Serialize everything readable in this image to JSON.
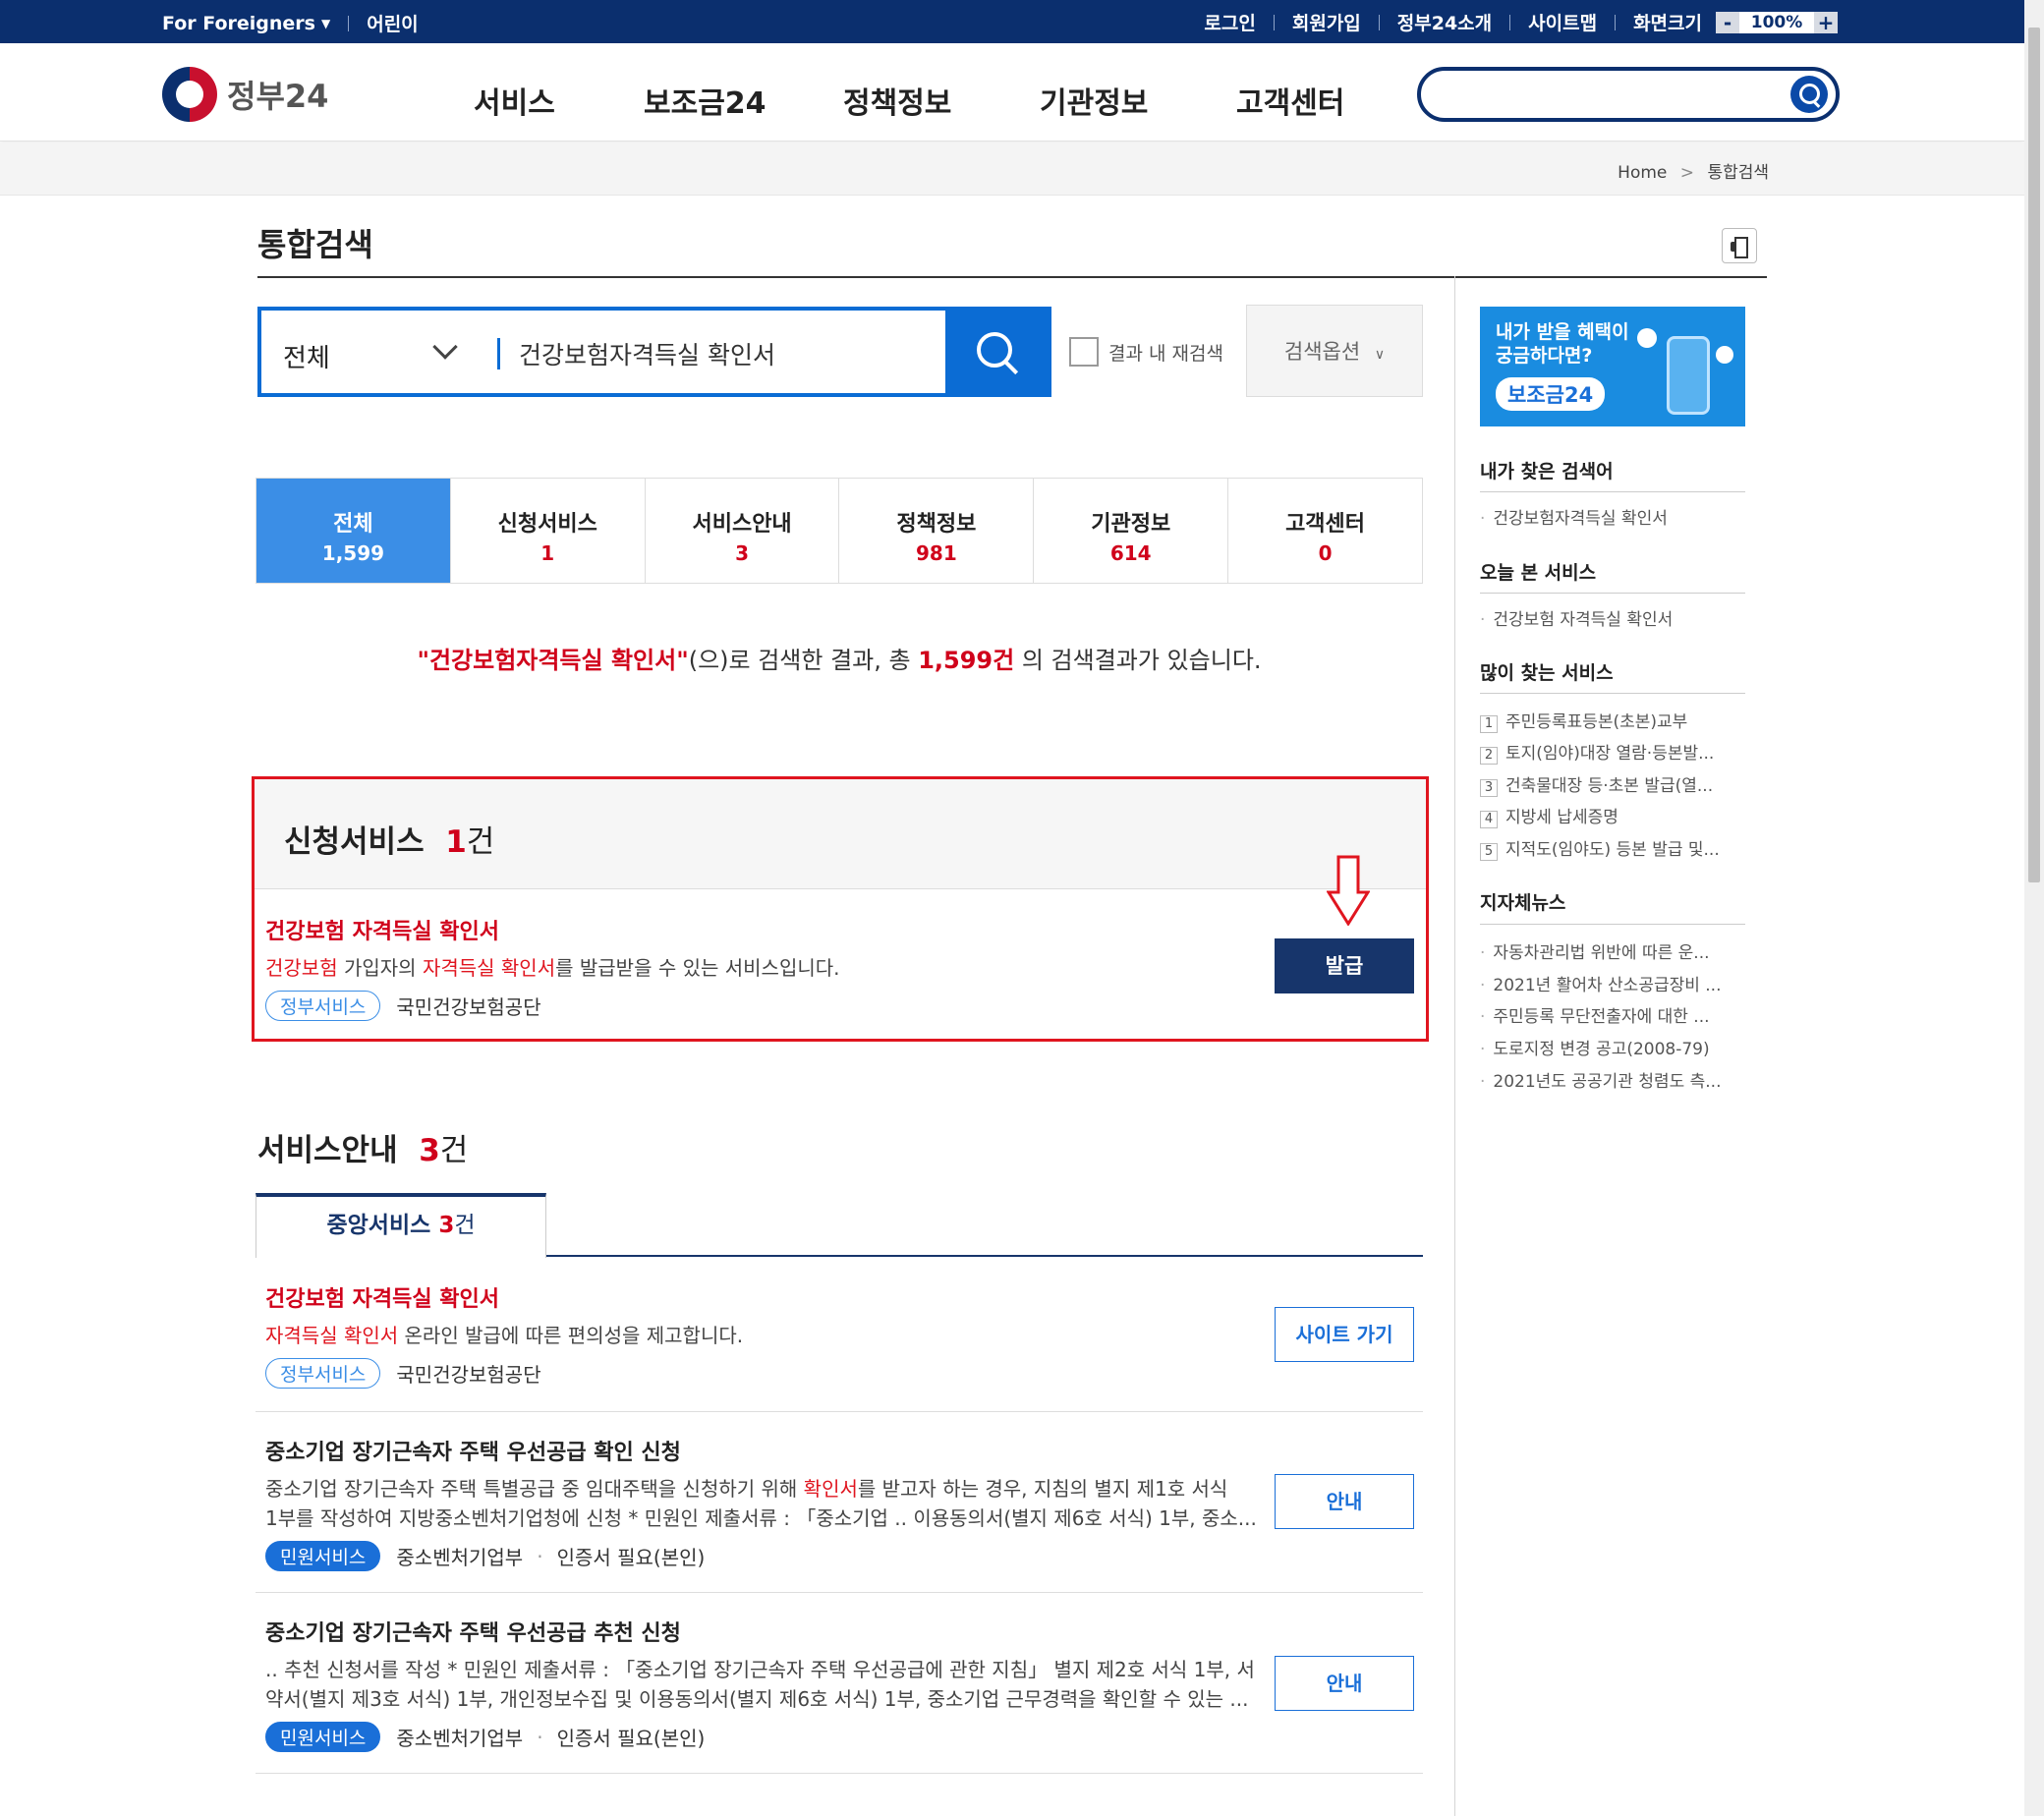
{
  "topbar": {
    "left": [
      "For Foreigners",
      "어린이"
    ],
    "right": [
      "로그인",
      "회원가입",
      "정부24소개",
      "사이트맵"
    ],
    "screen_size_label": "화면크기",
    "zoom_minus": "-",
    "zoom_value": "100%",
    "zoom_plus": "+"
  },
  "header": {
    "logo_text": "정부24",
    "menu": [
      "서비스",
      "보조금24",
      "정책정보",
      "기관정보",
      "고객센터"
    ]
  },
  "breadcrumb": {
    "home": "Home",
    "sep": ">",
    "current": "통합검색"
  },
  "page_title": "통합검색",
  "search": {
    "category": "전체",
    "query": "건강보험자격득실 확인서",
    "research_label": "결과 내 재검색",
    "options_label": "검색옵션"
  },
  "tabs": [
    {
      "label": "전체",
      "count": "1,599"
    },
    {
      "label": "신청서비스",
      "count": "1"
    },
    {
      "label": "서비스안내",
      "count": "3"
    },
    {
      "label": "정책정보",
      "count": "981"
    },
    {
      "label": "기관정보",
      "count": "614"
    },
    {
      "label": "고객센터",
      "count": "0"
    }
  ],
  "summary": {
    "quote": "\"건강보험자격득실 확인서\"",
    "mid": "(으)로 검색한 결과, 총 ",
    "total": "1,599건",
    "end": " 의 검색결과가 있습니다."
  },
  "apply_section": {
    "title": "신청서비스",
    "count": "1",
    "unit": "건",
    "item": {
      "title": "건강보험 자격득실 확인서",
      "desc_parts": [
        "건강보험",
        " 가입자의 ",
        "자격득실 확인서",
        "를 발급받을 수 있는 서비스입니다."
      ],
      "tag": "정부서비스",
      "org": "국민건강보험공단",
      "button": "발급"
    }
  },
  "guide_section": {
    "title": "서비스안내",
    "count": "3",
    "unit": "건",
    "subtab": {
      "label": "중앙서비스",
      "count": "3",
      "unit": "건"
    },
    "items": [
      {
        "title": "건강보험 자격득실 확인서",
        "desc_parts": [
          "자격득실 확인서",
          " 온라인 발급에 따른 편의성을 제고합니다."
        ],
        "tag": "정부서비스",
        "org": "국민건강보험공단",
        "button": "사이트 가기"
      },
      {
        "title": "중소기업 장기근속자 주택 우선공급 확인 신청",
        "desc_line1_parts": [
          "중소기업 장기근속자 주택 특별공급 중 임대주택을 신청하기 위해 ",
          "확인서",
          "를 받고자 하는 경우, 지침의 별지 제1호 서식"
        ],
        "desc_line2": "1부를 작성하여 지방중소벤처기업청에 신청 * 민원인 제출서류 : 「중소기업 .. 이용동의서(별지 제6호 서식) 1부, 중소...",
        "tag": "민원서비스",
        "org": "중소벤처기업부",
        "extra": "인증서 필요(본인)",
        "button": "안내"
      },
      {
        "title": "중소기업 장기근속자 주택 우선공급 추천 신청",
        "desc_line1": ".. 추천 신청서를 작성 * 민원인 제출서류 : 「중소기업 장기근속자 주택 우선공급에 관한 지침」 별지 제2호 서식 1부, 서",
        "desc_line2": "약서(별지 제3호 서식) 1부, 개인정보수집 및 이용동의서(별지 제6호 서식) 1부, 중소기업 근무경력을 확인할 수 있는 ...",
        "tag": "민원서비스",
        "org": "중소벤처기업부",
        "extra": "인증서 필요(본인)",
        "button": "안내"
      }
    ]
  },
  "sidebar": {
    "banner_line1": "내가 받을 혜택이",
    "banner_line2": "궁금하다면?",
    "banner_pill": "보조금24",
    "my_searches_title": "내가 찾은 검색어",
    "my_searches": [
      "건강보험자격득실 확인서"
    ],
    "today_title": "오늘 본 서비스",
    "today": [
      "건강보험 자격득실 확인서"
    ],
    "popular_title": "많이 찾는 서비스",
    "popular": [
      {
        "n": "1",
        "t": "주민등록표등본(초본)교부"
      },
      {
        "n": "2",
        "t": "토지(임야)대장 열람·등본발..."
      },
      {
        "n": "3",
        "t": "건축물대장 등·초본 발급(열..."
      },
      {
        "n": "4",
        "t": "지방세 납세증명"
      },
      {
        "n": "5",
        "t": "지적도(임야도) 등본 발급 및..."
      }
    ],
    "news_title": "지자체뉴스",
    "news": [
      "자동차관리법 위반에 따른 운...",
      "2021년 활어차 산소공급장비 ...",
      "주민등록 무단전출자에 대한 ...",
      "도로지정 변경 공고(2008-79)",
      "2021년도 공공기관 청렴도 측..."
    ]
  },
  "colors": {
    "navy": "#0b2f6e",
    "blue": "#0b6cd4",
    "red": "#d0021b",
    "highlight_box": "#e0151f"
  }
}
